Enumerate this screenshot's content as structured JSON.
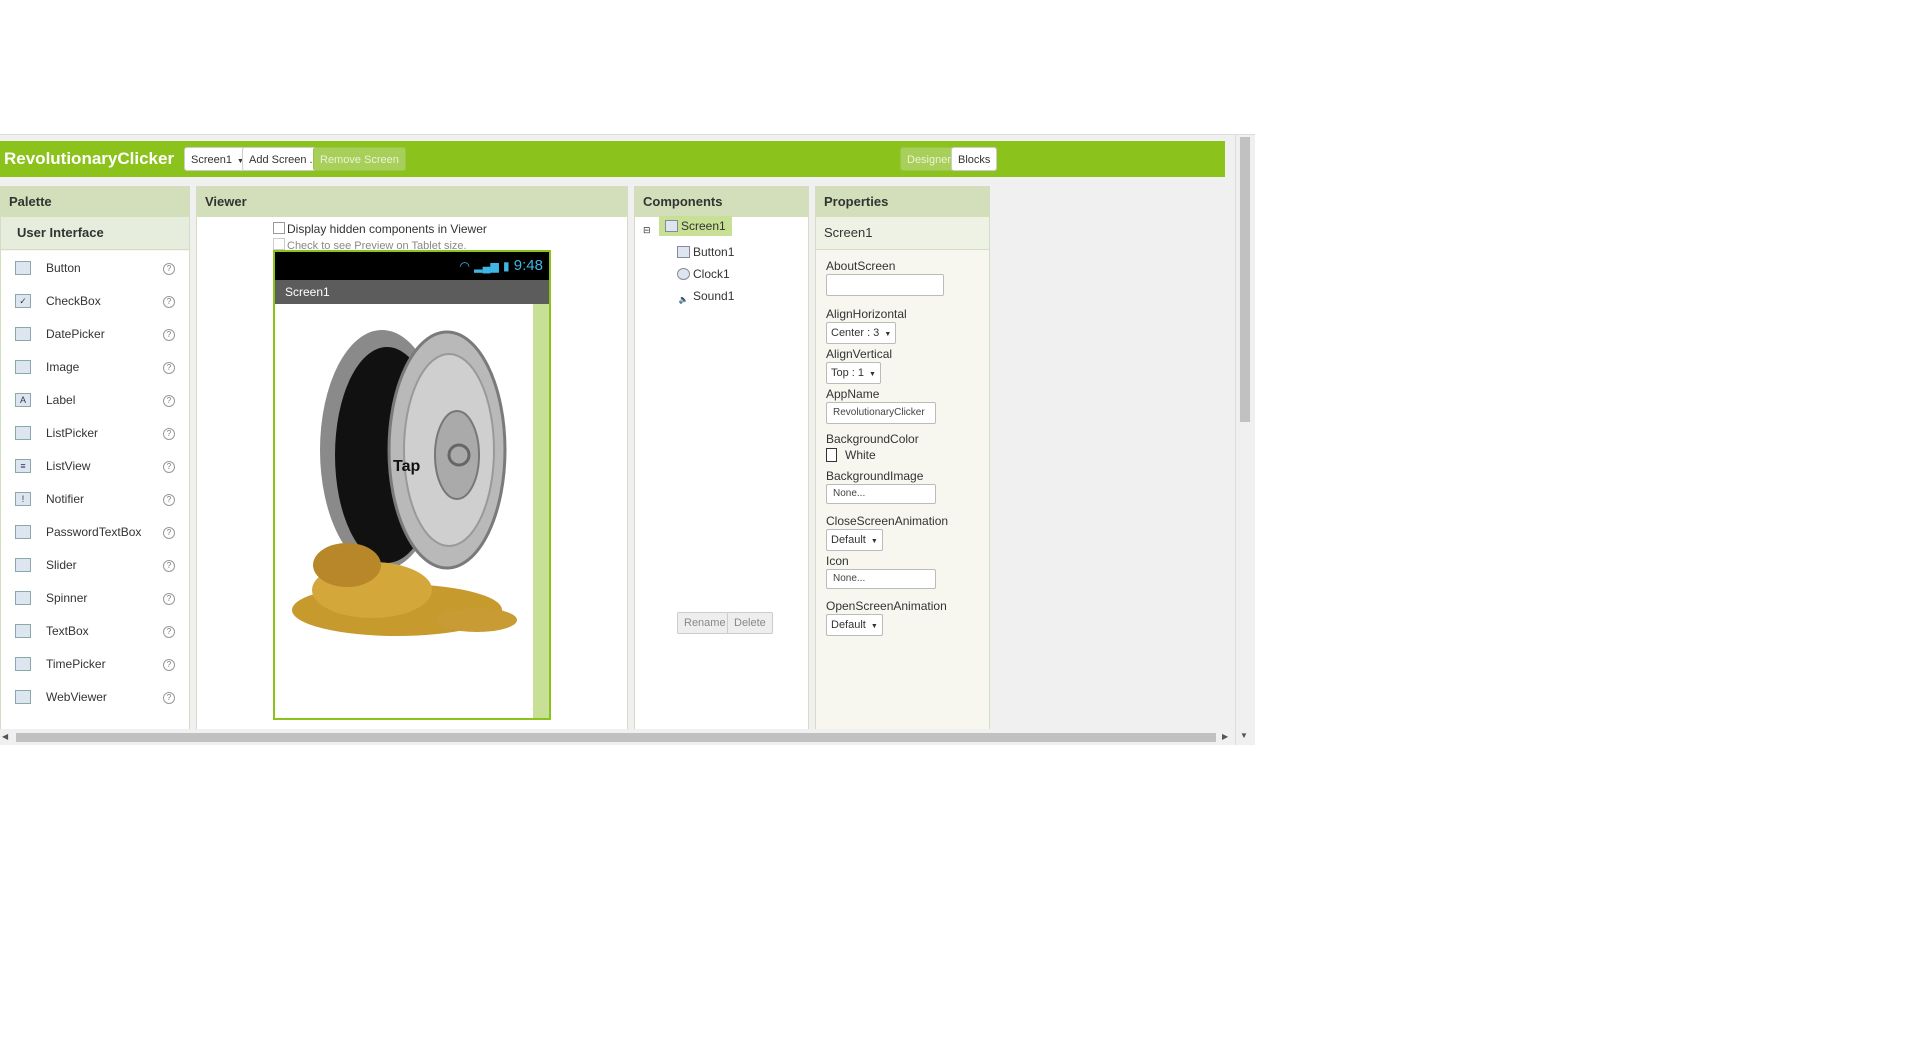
{
  "topbar": {
    "app_title": "RevolutionaryClicker",
    "screen_select": "Screen1",
    "add_screen": "Add Screen ...",
    "remove_screen": "Remove Screen",
    "designer": "Designer",
    "blocks": "Blocks",
    "accent_color": "#8cc21c"
  },
  "palette": {
    "title": "Palette",
    "category": "User Interface",
    "items": [
      {
        "label": "Button",
        "icon": "button-icon"
      },
      {
        "label": "CheckBox",
        "icon": "checkbox-icon"
      },
      {
        "label": "DatePicker",
        "icon": "datepicker-icon"
      },
      {
        "label": "Image",
        "icon": "image-icon"
      },
      {
        "label": "Label",
        "icon": "label-icon"
      },
      {
        "label": "ListPicker",
        "icon": "listpicker-icon"
      },
      {
        "label": "ListView",
        "icon": "listview-icon"
      },
      {
        "label": "Notifier",
        "icon": "notifier-icon"
      },
      {
        "label": "PasswordTextBox",
        "icon": "passwordtextbox-icon"
      },
      {
        "label": "Slider",
        "icon": "slider-icon"
      },
      {
        "label": "Spinner",
        "icon": "spinner-icon"
      },
      {
        "label": "TextBox",
        "icon": "textbox-icon"
      },
      {
        "label": "TimePicker",
        "icon": "timepicker-icon"
      },
      {
        "label": "WebViewer",
        "icon": "webviewer-icon"
      }
    ]
  },
  "viewer": {
    "title": "Viewer",
    "hidden_checkbox": "Display hidden components in Viewer",
    "tablet_checkbox": "Check to see Preview on Tablet size.",
    "phone": {
      "time": "9:48",
      "screen_title": "Screen1",
      "button_text": "Tap"
    }
  },
  "components": {
    "title": "Components",
    "root": "Screen1",
    "children": [
      "Button1",
      "Clock1",
      "Sound1"
    ],
    "rename": "Rename",
    "delete": "Delete"
  },
  "properties": {
    "title": "Properties",
    "component": "Screen1",
    "about_screen": {
      "label": "AboutScreen",
      "value": ""
    },
    "align_horizontal": {
      "label": "AlignHorizontal",
      "value": "Center : 3"
    },
    "align_vertical": {
      "label": "AlignVertical",
      "value": "Top : 1"
    },
    "app_name": {
      "label": "AppName",
      "value": "RevolutionaryClicker"
    },
    "background_color": {
      "label": "BackgroundColor",
      "value": "White"
    },
    "background_image": {
      "label": "BackgroundImage",
      "value": "None..."
    },
    "close_screen_animation": {
      "label": "CloseScreenAnimation",
      "value": "Default"
    },
    "icon": {
      "label": "Icon",
      "value": "None..."
    },
    "open_screen_animation": {
      "label": "OpenScreenAnimation",
      "value": "Default"
    }
  }
}
